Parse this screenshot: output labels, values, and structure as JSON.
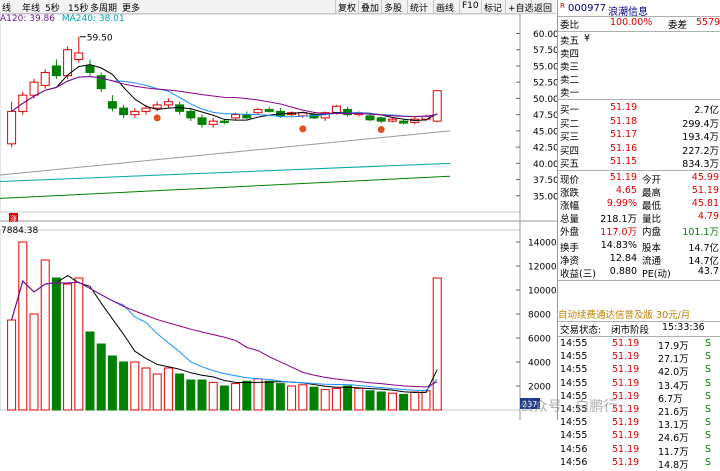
{
  "toolbar": {
    "items": [
      "线",
      "年线",
      "5秒",
      "15秒",
      "多周期",
      "更多",
      "复权",
      "叠加",
      "多股",
      "统计",
      "画线",
      "F10",
      "标记",
      "+自选",
      "返回"
    ]
  },
  "ma_legend": {
    "ma120": "A120: 39.86",
    "ma240": "MA240: 38.01",
    "peak": "59.50",
    "vol": "7884.38",
    "zhang": "涨",
    "vol_cur": "237"
  },
  "price_axis": [
    "60.00",
    "57.50",
    "55.00",
    "52.50",
    "50.00",
    "47.50",
    "45.00",
    "42.50",
    "40.00",
    "37.50",
    "35.00"
  ],
  "vol_axis": [
    "14000",
    "12000",
    "10000",
    "8000",
    "6000",
    "4000",
    "2000"
  ],
  "stock": {
    "code": "000977",
    "name": "浪潮信息",
    "r": "R"
  },
  "quote": {
    "weibi_label": "委比",
    "weibi": "100.00%",
    "weicha_label": "委差",
    "weicha": "5579",
    "sell": [
      {
        "l": "卖五",
        "p": "¥",
        "v": ""
      },
      {
        "l": "卖四",
        "p": "",
        "v": ""
      },
      {
        "l": "卖三",
        "p": "",
        "v": ""
      },
      {
        "l": "卖二",
        "p": "",
        "v": ""
      },
      {
        "l": "卖一",
        "p": "",
        "v": ""
      }
    ],
    "buy": [
      {
        "l": "买一",
        "p": "51.19",
        "v": "2.7亿"
      },
      {
        "l": "买二",
        "p": "51.18",
        "v": "299.4万"
      },
      {
        "l": "买三",
        "p": "51.17",
        "v": "193.4万"
      },
      {
        "l": "买四",
        "p": "51.16",
        "v": "227.2万"
      },
      {
        "l": "买五",
        "p": "51.15",
        "v": "834.3万"
      }
    ],
    "stats": [
      {
        "a": "现价",
        "b": "51.19",
        "c": "今开",
        "d": "45.99",
        "bc": "red",
        "dc": "red"
      },
      {
        "a": "涨跌",
        "b": "4.65",
        "c": "最高",
        "d": "51.19",
        "bc": "red",
        "dc": "red"
      },
      {
        "a": "涨幅",
        "b": "9.99%",
        "c": "最低",
        "d": "45.81",
        "bc": "red",
        "dc": "red"
      },
      {
        "a": "总量",
        "b": "218.1万",
        "c": "量比",
        "d": "4.79",
        "bc": "",
        "dc": "red"
      },
      {
        "a": "外盘",
        "b": "117.0万",
        "c": "内盘",
        "d": "101.1万",
        "bc": "red",
        "dc": "green"
      },
      {
        "a": "换手",
        "b": "14.83%",
        "c": "股本",
        "d": "14.7亿",
        "bc": "",
        "dc": ""
      },
      {
        "a": "净资",
        "b": "12.84",
        "c": "流通",
        "d": "14.7亿",
        "bc": "",
        "dc": ""
      },
      {
        "a": "收益(三)",
        "b": "0.880",
        "c": "PE(动)",
        "d": "43.7",
        "bc": "",
        "dc": ""
      }
    ],
    "ad": "自动续费通达信普及版  30元/月",
    "status_label": "交易状态:",
    "status": "闭市阶段",
    "time": "15:33:36",
    "ticks": [
      {
        "t": "14:55",
        "p": "51.19",
        "v": "17.9万",
        "s": "S"
      },
      {
        "t": "14:55",
        "p": "51.19",
        "v": "27.1万",
        "s": "S"
      },
      {
        "t": "14:55",
        "p": "51.19",
        "v": "42.0万",
        "s": "S"
      },
      {
        "t": "14:55",
        "p": "51.19",
        "v": "13.4万",
        "s": "S"
      },
      {
        "t": "14:55",
        "p": "51.19",
        "v": "6.7万",
        "s": "S"
      },
      {
        "t": "14:55",
        "p": "51.19",
        "v": "21.6万",
        "s": "S"
      },
      {
        "t": "14:55",
        "p": "51.19",
        "v": "13.1万",
        "s": "S"
      },
      {
        "t": "14:55",
        "p": "51.19",
        "v": "24.6万",
        "s": "S"
      },
      {
        "t": "14:56",
        "p": "51.19",
        "v": "11.7万",
        "s": "S"
      },
      {
        "t": "14:56",
        "p": "51.19",
        "v": "14.8万",
        "s": "S"
      }
    ]
  },
  "watermark": "公众号 · 白鹏行",
  "candles": [
    [
      43,
      49.5,
      42.5,
      48
    ],
    [
      48,
      51,
      47.5,
      50.5
    ],
    [
      50.5,
      53,
      50,
      52.5
    ],
    [
      52,
      54.5,
      51.5,
      54
    ],
    [
      55,
      56,
      53,
      53.5
    ],
    [
      53.5,
      58,
      53,
      57.5
    ],
    [
      56,
      59.5,
      55.5,
      57
    ],
    [
      55,
      56,
      53.5,
      54
    ],
    [
      53.5,
      54,
      51,
      51.5
    ],
    [
      49.5,
      50.5,
      48,
      48.5
    ],
    [
      48.5,
      49,
      47,
      47.5
    ],
    [
      47.5,
      48.5,
      47,
      48
    ],
    [
      48,
      49,
      47.5,
      48.5
    ],
    [
      48.5,
      49.5,
      48,
      49
    ],
    [
      49,
      50,
      48.5,
      49.5
    ],
    [
      49,
      49.5,
      47.5,
      48
    ],
    [
      48,
      48.5,
      46.5,
      47
    ],
    [
      47,
      47.5,
      45.5,
      46
    ],
    [
      46,
      47,
      45.5,
      46.5
    ],
    [
      46.5,
      46.8,
      46,
      46.3
    ],
    [
      47,
      47.8,
      46.7,
      47.5
    ],
    [
      47.5,
      48,
      46.8,
      47
    ],
    [
      47.8,
      48.5,
      47.5,
      48.3
    ],
    [
      48.3,
      48.7,
      47.8,
      48
    ],
    [
      48,
      48.5,
      47,
      47.3
    ],
    [
      47.5,
      48,
      47.3,
      47.8
    ],
    [
      47.3,
      48,
      47,
      47.8
    ],
    [
      47.5,
      47.8,
      46.8,
      47
    ],
    [
      47,
      48,
      46.5,
      47.8
    ],
    [
      47.8,
      49,
      47.5,
      48.8
    ],
    [
      48.3,
      48.7,
      47.2,
      47.5
    ],
    [
      47.5,
      48,
      47.2,
      47.8
    ],
    [
      47.3,
      47.6,
      46.5,
      46.7
    ],
    [
      47,
      47.2,
      46.2,
      46.5
    ],
    [
      46.5,
      47,
      46.3,
      46.8
    ],
    [
      46.5,
      46.8,
      46,
      46.2
    ],
    [
      46.3,
      47.2,
      46,
      46.8
    ],
    [
      46.8,
      47.5,
      46.5,
      47.2
    ],
    [
      46.5,
      51.19,
      46.3,
      51.19
    ]
  ],
  "volumes": [
    7.5,
    14,
    8,
    12.5,
    11,
    10.5,
    11,
    6.5,
    5.5,
    4.5,
    4,
    4,
    3.5,
    3,
    3.5,
    3,
    2.5,
    2.5,
    2.3,
    2,
    2.2,
    2.4,
    2.6,
    2.4,
    2.2,
    2,
    2.1,
    1.9,
    1.7,
    1.8,
    2,
    1.8,
    1.6,
    1.5,
    1.4,
    1.3,
    1.5,
    1.6,
    11
  ]
}
